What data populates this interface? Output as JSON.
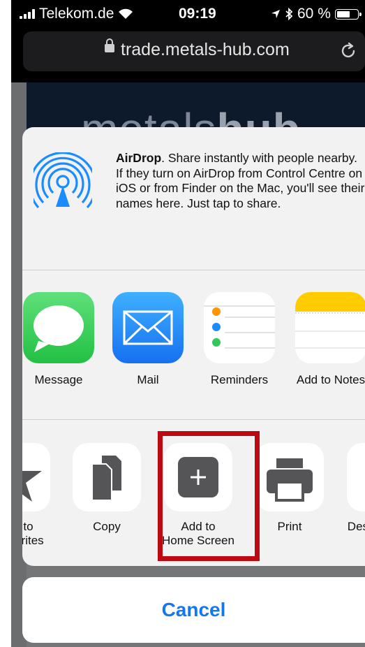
{
  "status_bar": {
    "carrier": "Telekom.de",
    "time": "09:19",
    "battery_percent": "60 %"
  },
  "url_bar": {
    "url": "trade.metals-hub.com"
  },
  "webpage": {
    "logo_light": "metals",
    "logo_bold": "hub"
  },
  "airdrop": {
    "title": "AirDrop",
    "description": ". Share instantly with people nearby. If they turn on AirDrop from Control Centre on iOS or from Finder on the Mac, you'll see their names here. Just tap to share."
  },
  "apps": [
    {
      "label": "Message",
      "icon": "messages-icon",
      "color": "#34c759"
    },
    {
      "label": "Mail",
      "icon": "mail-icon",
      "color": "#1a8cff"
    },
    {
      "label": "Reminders",
      "icon": "reminders-icon",
      "color": "#ffffff"
    },
    {
      "label": "Add to Notes",
      "icon": "notes-icon",
      "color": "#ffcc00"
    }
  ],
  "actions": [
    {
      "label": "Add to\nFavourites",
      "icon": "star-icon"
    },
    {
      "label": "Copy",
      "icon": "copy-icon"
    },
    {
      "label": "Add to\nHome Screen",
      "icon": "add-to-home-icon",
      "highlighted": true
    },
    {
      "label": "Print",
      "icon": "print-icon"
    },
    {
      "label": "Desktop Site",
      "icon": "desktop-icon"
    }
  ],
  "cancel_label": "Cancel",
  "colors": {
    "accent": "#1378f0",
    "highlight_border": "#bd0a12"
  }
}
